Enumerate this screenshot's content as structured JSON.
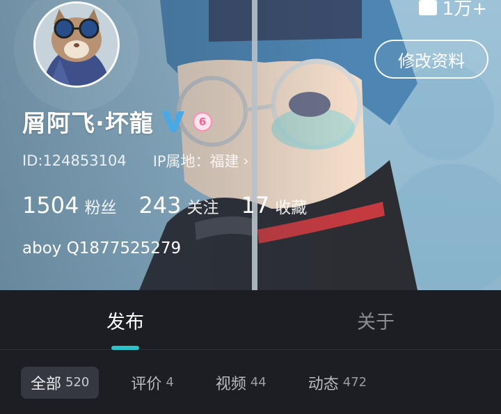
{
  "header": {
    "likes_count": "1万+",
    "edit_button_label": "修改资料",
    "name": "屑阿飞·坏龍",
    "level_badge": "6",
    "user_id": "ID:124853104",
    "ip_location": "IP属地：福建",
    "stats": [
      {
        "num": "1504",
        "label": "粉丝"
      },
      {
        "num": "243",
        "label": "关注"
      },
      {
        "num": "17",
        "label": "收藏"
      }
    ],
    "bio": "aboy Q1877525279"
  },
  "tabs": [
    {
      "label": "发布",
      "active": true
    },
    {
      "label": "关于",
      "active": false
    }
  ],
  "filters": [
    {
      "label": "全部",
      "count": "520",
      "active": true
    },
    {
      "label": "评价",
      "count": "4",
      "active": false
    },
    {
      "label": "视频",
      "count": "44",
      "active": false
    },
    {
      "label": "动态",
      "count": "472",
      "active": false
    }
  ],
  "colors": {
    "accent": "#2bc3c9",
    "verified": "#4aa8e6",
    "background": "#1c1e24"
  }
}
